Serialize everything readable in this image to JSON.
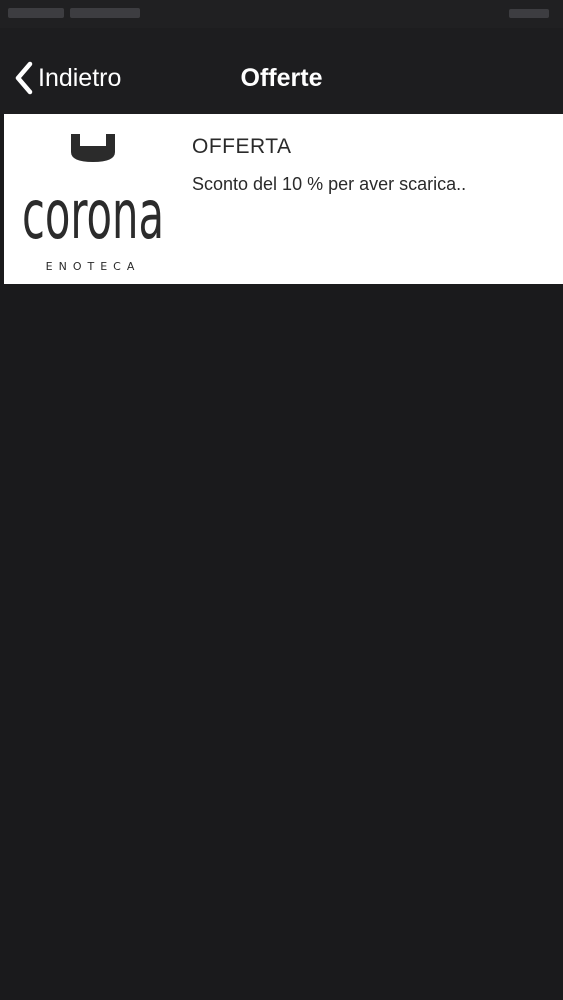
{
  "nav": {
    "back_label": "Indietro",
    "title": "Offerte"
  },
  "offers": [
    {
      "logo_text": "corona",
      "logo_subtext": "ENOTECA",
      "title": "OFFERTA",
      "description": "Sconto del 10 % per aver scarica.."
    }
  ],
  "colors": {
    "background": "#1a1a1c",
    "nav_background": "#1d1d1f",
    "nav_text": "#ffffff",
    "row_background": "#ffffff",
    "row_text": "#2a2a2a"
  },
  "icons": {
    "back": "chevron-left-icon"
  }
}
